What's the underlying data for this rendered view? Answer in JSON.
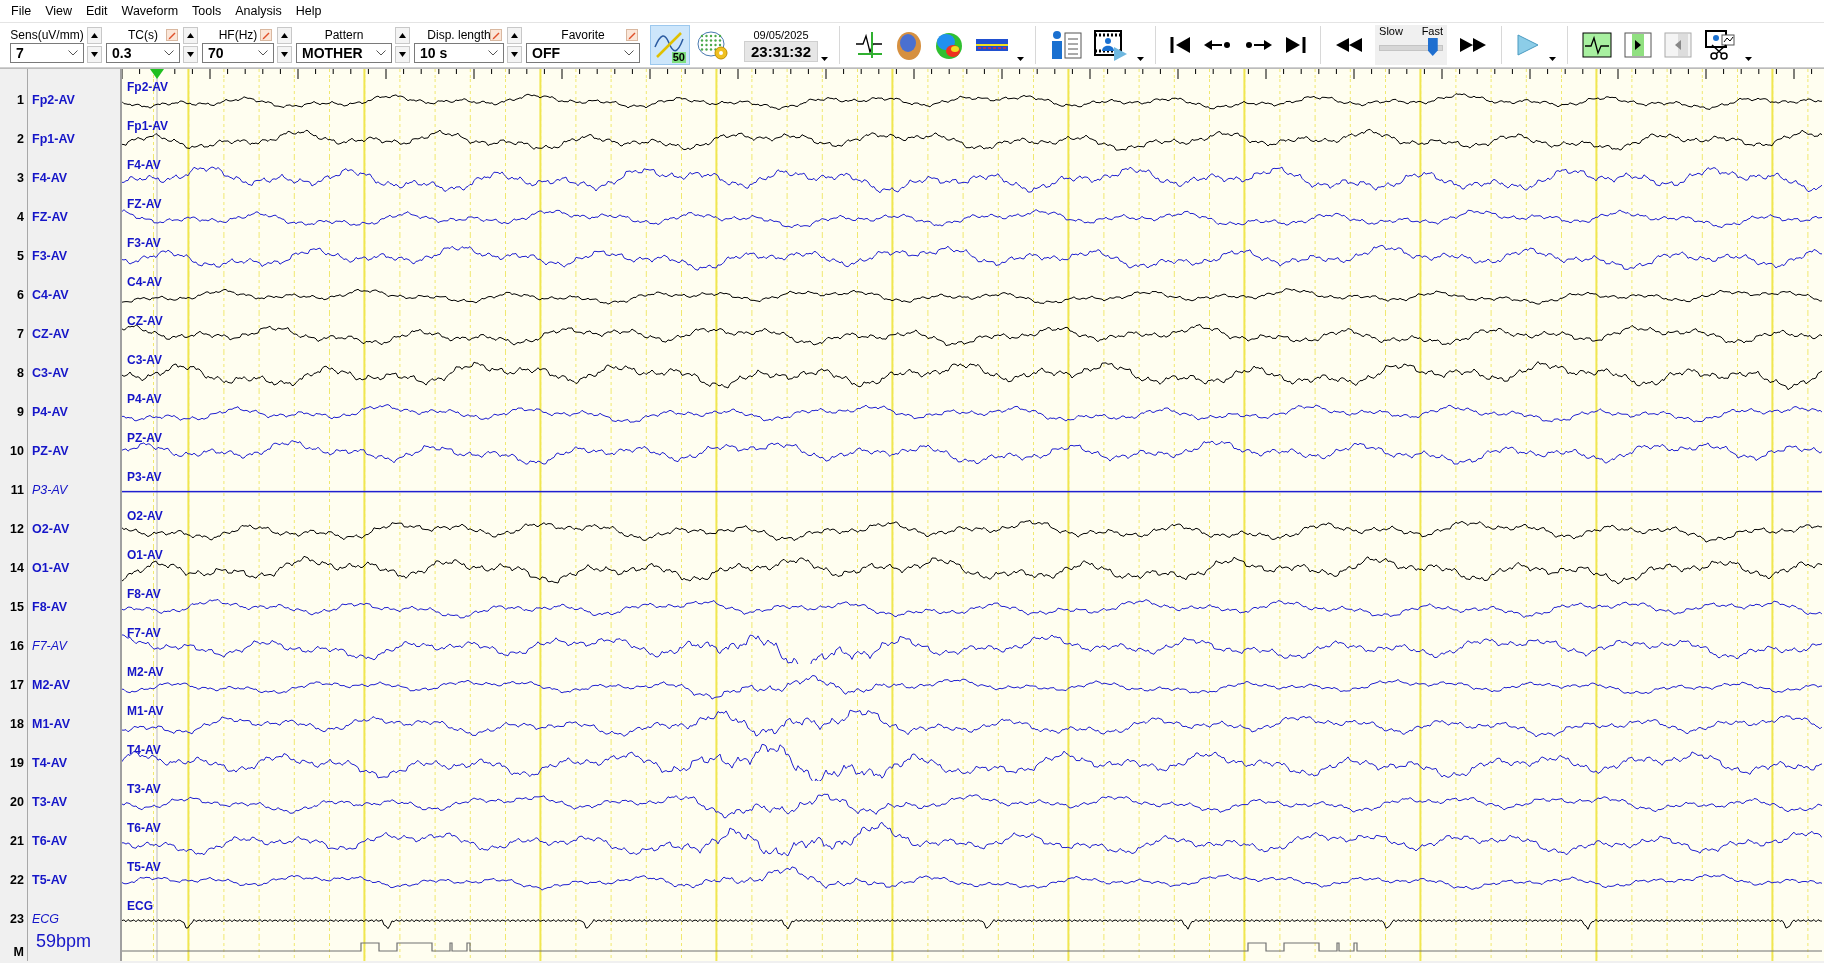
{
  "menu": [
    {
      "label": "File"
    },
    {
      "label": "View"
    },
    {
      "label": "Edit"
    },
    {
      "label": "Waveform"
    },
    {
      "label": "Tools"
    },
    {
      "label": "Analysis"
    },
    {
      "label": "Help"
    }
  ],
  "toolbar": {
    "fields": [
      {
        "label": "Sens(uV/mm)",
        "value": "7",
        "editable": false,
        "spinner": true
      },
      {
        "label": "TC(s)",
        "value": "0.3",
        "editable": true,
        "spinner": true
      },
      {
        "label": "HF(Hz)",
        "value": "70",
        "editable": true,
        "spinner": true
      },
      {
        "label": "Pattern",
        "value": "MOTHER",
        "editable": false,
        "spinner": true
      },
      {
        "label": "Disp. length",
        "value": "10 s",
        "editable": true,
        "spinner": true
      },
      {
        "label": "Favorite",
        "value": "OFF",
        "editable": true,
        "spinner": false
      }
    ],
    "filter_button": {
      "badge": "50",
      "pressed": true
    },
    "date": "09/05/2025",
    "time": "23:31:32",
    "speed": {
      "slow_label": "Slow",
      "fast_label": "Fast",
      "level": 0.85
    }
  },
  "channels": [
    {
      "number": "1",
      "name": "Fp2-AV",
      "trace_label": "Fp2-AV",
      "inactive": false,
      "kind": "eeg",
      "color": "#000000",
      "flat": false
    },
    {
      "number": "2",
      "name": "Fp1-AV",
      "trace_label": "Fp1-AV",
      "inactive": false,
      "kind": "eeg",
      "color": "#000000",
      "flat": false
    },
    {
      "number": "3",
      "name": "F4-AV",
      "trace_label": "F4-AV",
      "inactive": false,
      "kind": "eeg",
      "color": "#1f1fd0",
      "flat": false
    },
    {
      "number": "4",
      "name": "FZ-AV",
      "trace_label": "FZ-AV",
      "inactive": false,
      "kind": "eeg",
      "color": "#1f1fd0",
      "flat": false
    },
    {
      "number": "5",
      "name": "F3-AV",
      "trace_label": "F3-AV",
      "inactive": false,
      "kind": "eeg",
      "color": "#1f1fd0",
      "flat": false
    },
    {
      "number": "6",
      "name": "C4-AV",
      "trace_label": "C4-AV",
      "inactive": false,
      "kind": "eeg",
      "color": "#000000",
      "flat": false
    },
    {
      "number": "7",
      "name": "CZ-AV",
      "trace_label": "CZ-AV",
      "inactive": false,
      "kind": "eeg",
      "color": "#000000",
      "flat": false
    },
    {
      "number": "8",
      "name": "C3-AV",
      "trace_label": "C3-AV",
      "inactive": false,
      "kind": "eeg",
      "color": "#000000",
      "flat": false
    },
    {
      "number": "9",
      "name": "P4-AV",
      "trace_label": "P4-AV",
      "inactive": false,
      "kind": "eeg",
      "color": "#1f1fd0",
      "flat": false
    },
    {
      "number": "10",
      "name": "PZ-AV",
      "trace_label": "PZ-AV",
      "inactive": false,
      "kind": "eeg",
      "color": "#1f1fd0",
      "flat": false
    },
    {
      "number": "11",
      "name": "P3-AV",
      "trace_label": "P3-AV",
      "inactive": true,
      "kind": "eeg",
      "color": "#1f1fd0",
      "flat": true
    },
    {
      "number": "12",
      "name": "O2-AV",
      "trace_label": "O2-AV",
      "inactive": false,
      "kind": "eeg",
      "color": "#000000",
      "flat": false
    },
    {
      "number": "14",
      "name": "O1-AV",
      "trace_label": "O1-AV",
      "inactive": false,
      "kind": "eeg",
      "color": "#000000",
      "flat": false
    },
    {
      "number": "15",
      "name": "F8-AV",
      "trace_label": "F8-AV",
      "inactive": false,
      "kind": "eeg",
      "color": "#1f1fd0",
      "flat": false
    },
    {
      "number": "16",
      "name": "F7-AV",
      "trace_label": "F7-AV",
      "inactive": true,
      "kind": "eeg",
      "color": "#1f1fd0",
      "flat": false
    },
    {
      "number": "17",
      "name": "M2-AV",
      "trace_label": "M2-AV",
      "inactive": false,
      "kind": "eeg",
      "color": "#1f1fd0",
      "flat": false
    },
    {
      "number": "18",
      "name": "M1-AV",
      "trace_label": "M1-AV",
      "inactive": false,
      "kind": "eeg",
      "color": "#1f1fd0",
      "flat": false
    },
    {
      "number": "19",
      "name": "T4-AV",
      "trace_label": "T4-AV",
      "inactive": false,
      "kind": "eeg",
      "color": "#1f1fd0",
      "flat": false
    },
    {
      "number": "20",
      "name": "T3-AV",
      "trace_label": "T3-AV",
      "inactive": false,
      "kind": "eeg",
      "color": "#1f1fd0",
      "flat": false
    },
    {
      "number": "21",
      "name": "T6-AV",
      "trace_label": "T6-AV",
      "inactive": false,
      "kind": "eeg",
      "color": "#1f1fd0",
      "flat": false
    },
    {
      "number": "22",
      "name": "T5-AV",
      "trace_label": "T5-AV",
      "inactive": false,
      "kind": "eeg",
      "color": "#1f1fd0",
      "flat": false
    },
    {
      "number": "23",
      "name": "ECG",
      "trace_label": "ECG",
      "inactive": true,
      "kind": "ecg",
      "color": "#000000",
      "flat": false
    }
  ],
  "marker_row": {
    "label": "M",
    "heart_rate": "59bpm"
  }
}
